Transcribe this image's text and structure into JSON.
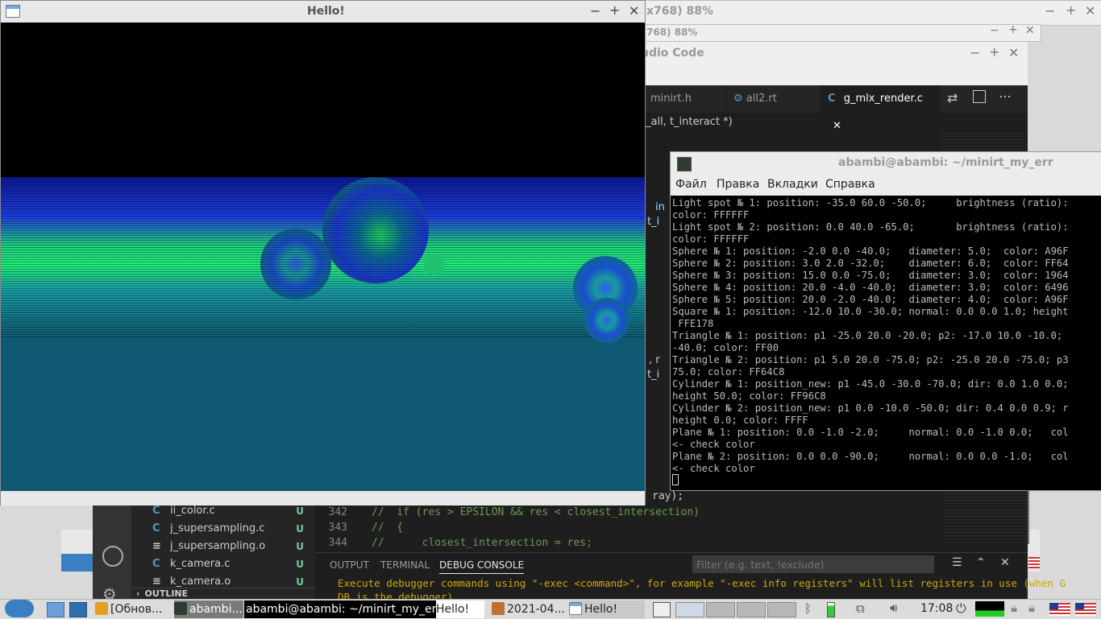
{
  "background_windows": {
    "title1": "x768) 88%",
    "title2": "768) 88%",
    "vscode_title": "udio Code"
  },
  "vscode": {
    "tabs": [
      {
        "label": "minirt.h",
        "icon": "C"
      },
      {
        "label": "all2.rt",
        "icon": "gear"
      },
      {
        "label": "g_mlx_render.c",
        "icon": "C"
      }
    ],
    "breadcrumb": "_all, t_interact *)",
    "code_fragments": {
      "in": "in",
      "t_i": "t_i",
      "r": ", r",
      "t_i2": "t_i",
      "ray": "ray);"
    },
    "files": [
      {
        "icon": "C",
        "name": "ii_color.c",
        "status": "U"
      },
      {
        "icon": "C",
        "name": "j_supersampling.c",
        "status": "U"
      },
      {
        "icon": "≡",
        "name": "j_supersampling.o",
        "status": "U"
      },
      {
        "icon": "C",
        "name": "k_camera.c",
        "status": "U"
      },
      {
        "icon": "≡",
        "name": "k_camera.o",
        "status": "U"
      }
    ],
    "outline_label": "OUTLINE",
    "code_lines": [
      {
        "num": "342",
        "text": "//  if (res > EPSILON && res < closest_intersection)"
      },
      {
        "num": "343",
        "text": "//  {"
      },
      {
        "num": "344",
        "text": "//      closest_intersection = res;"
      }
    ],
    "panel_tabs": [
      "OUTPUT",
      "TERMINAL",
      "DEBUG CONSOLE"
    ],
    "filter_placeholder": "Filter (e.g. text, !exclude)",
    "console_lines": [
      "Execute debugger commands using \"-exec <command>\", for example \"-exec info registers\" will list registers in use (when G",
      "DB is the debugger)"
    ]
  },
  "terminal": {
    "title": "abambi@abambi: ~/minirt_my_err",
    "menu": [
      "Файл",
      "Правка",
      "Вкладки",
      "Справка"
    ],
    "lines": [
      "Light spot № 1: position: -35.0 60.0 -50.0;     brightness (ratio):",
      "color: FFFFFF",
      "Light spot № 2: position: 0.0 40.0 -65.0;       brightness (ratio):",
      "color: FFFFFF",
      "Sphere № 1: position: -2.0 0.0 -40.0;   diameter: 5.0;  color: A96F",
      "Sphere № 2: position: 3.0 2.0 -32.0;    diameter: 6.0;  color: FF64",
      "Sphere № 3: position: 15.0 0.0 -75.0;   diameter: 3.0;  color: 1964",
      "Sphere № 4: position: 20.0 -4.0 -40.0;  diameter: 3.0;  color: 6496",
      "Sphere № 5: position: 20.0 -2.0 -40.0;  diameter: 4.0;  color: A96F",
      "Square № 1: position: -12.0 10.0 -30.0; normal: 0.0 0.0 1.0; height",
      " FFE178",
      "Triangle № 1: position: p1 -25.0 20.0 -20.0; p2: -17.0 10.0 -10.0;",
      "-40.0; color: FF00",
      "Triangle № 2: position: p1 5.0 20.0 -75.0; p2: -25.0 20.0 -75.0; p3",
      "75.0; color: FF64C8",
      "Cylinder № 1: position_new: p1 -45.0 -30.0 -70.0; dir: 0.0 1.0 0.0;",
      "height 50.0; color: FF96C8",
      "Cylinder № 2: position_new: p1 0.0 -10.0 -50.0; dir: 0.4 0.0 0.9; r",
      "height 0.0; color: FFFF",
      "Plane № 1: position: 0.0 -1.0 -2.0;     normal: 0.0 -1.0 0.0;   col",
      "<- check color",
      "Plane № 2: position: 0.0 0.0 -90.0;     normal: 0.0 0.0 -1.0;   col",
      "<- check color"
    ]
  },
  "hello_window": {
    "title": "Hello!"
  },
  "taskbar": {
    "items": [
      "[Обнов...",
      "abambi...",
      "abambi@abambi: ~/minirt_my_err",
      "Hello!",
      "2021-04...",
      "Hello!"
    ],
    "clock": "17:08"
  },
  "colors": {
    "vscode_bg": "#1e1e1e",
    "sidebar_bg": "#252526",
    "activity_bg": "#333333",
    "accent_blue": "#519aba",
    "git_untracked": "#73c991",
    "comment_green": "#6a9955",
    "render_floor": "#0f5a72"
  }
}
